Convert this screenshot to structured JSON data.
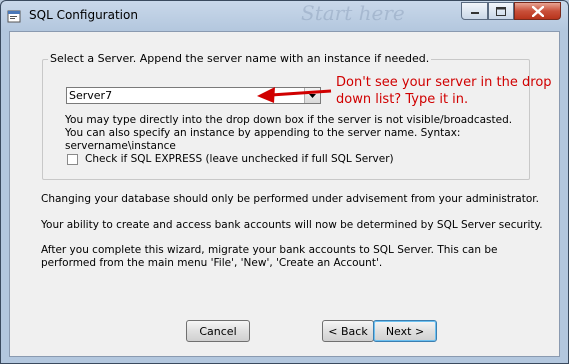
{
  "window": {
    "title": "SQL Configuration",
    "background_watermark": "Start here"
  },
  "server_group": {
    "legend": "Select a Server.  Append the server name with an instance if needed.",
    "server_value": "Server7",
    "hint": "You may type directly into the drop down box if the server is not visible/broadcasted.  You can also specify an instance by appending to the server name.  Syntax: servername\\instance",
    "express_label": "Check if SQL EXPRESS (leave unchecked if full SQL Server)",
    "express_checked": false
  },
  "info": {
    "change": "Changing your database should only be performed under advisement from your administrator.",
    "ability": "Your ability to create and access bank accounts will now be determined by SQL Server security.",
    "after": "After you complete this wizard, migrate your bank accounts to SQL Server.  This can be performed from the main menu 'File', 'New', 'Create an Account'."
  },
  "buttons": {
    "cancel": "Cancel",
    "back": "< Back",
    "next": "Next >"
  },
  "annotation": {
    "text": "Don't see your server in the drop down list? Type it in.",
    "color": "#d00000"
  },
  "colors": {
    "titlebar": "#c9d8ea",
    "client_bg": "#f0f0f0",
    "close_button": "#c9503a"
  }
}
